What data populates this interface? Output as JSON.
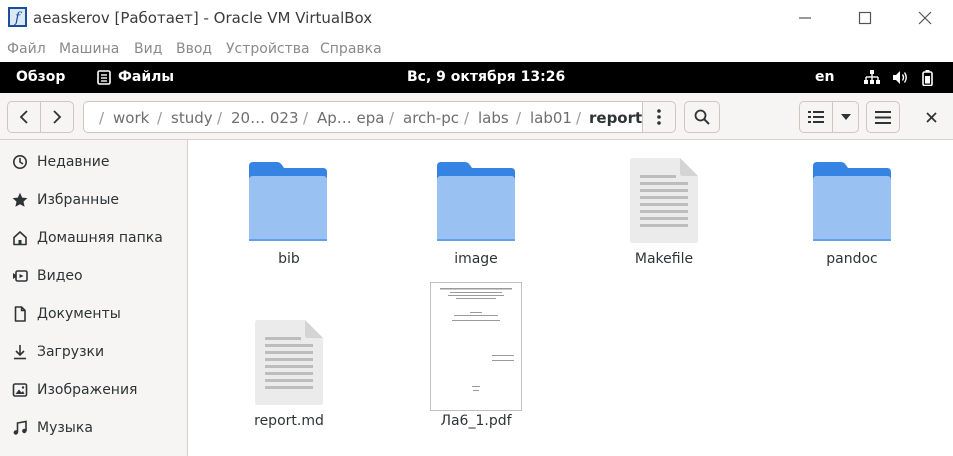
{
  "host_window": {
    "title": "aeaskerov [Работает] - Oracle VM VirtualBox",
    "menu": [
      "Файл",
      "Машина",
      "Вид",
      "Ввод",
      "Устройства",
      "Справка"
    ]
  },
  "gnome_bar": {
    "overview": "Обзор",
    "app_name": "Файлы",
    "clock": "Вс, 9 октября  13:26",
    "lang": "en"
  },
  "pathbar": {
    "segments": [
      "work",
      "study",
      "20… 023",
      "Ар… ера",
      "arch-pc",
      "labs",
      "lab01",
      "report"
    ],
    "separator": "/"
  },
  "sidebar": {
    "items": [
      {
        "label": "Недавние",
        "icon": "clock-icon"
      },
      {
        "label": "Избранные",
        "icon": "star-icon"
      },
      {
        "label": "Домашняя папка",
        "icon": "home-icon"
      },
      {
        "label": "Видео",
        "icon": "video-icon"
      },
      {
        "label": "Документы",
        "icon": "document-icon"
      },
      {
        "label": "Загрузки",
        "icon": "download-icon"
      },
      {
        "label": "Изображения",
        "icon": "image-icon"
      },
      {
        "label": "Музыка",
        "icon": "music-icon"
      }
    ]
  },
  "files": [
    {
      "name": "bib",
      "type": "folder"
    },
    {
      "name": "image",
      "type": "folder"
    },
    {
      "name": "Makefile",
      "type": "text"
    },
    {
      "name": "pandoc",
      "type": "folder"
    },
    {
      "name": "report.md",
      "type": "text"
    },
    {
      "name": "Ла6_1.pdf",
      "type": "pdf"
    }
  ],
  "colors": {
    "folder_top": "#3584e4",
    "folder_body": "#99c1f1",
    "top_bar": "#000000",
    "headerbar": "#f6f5f4"
  }
}
